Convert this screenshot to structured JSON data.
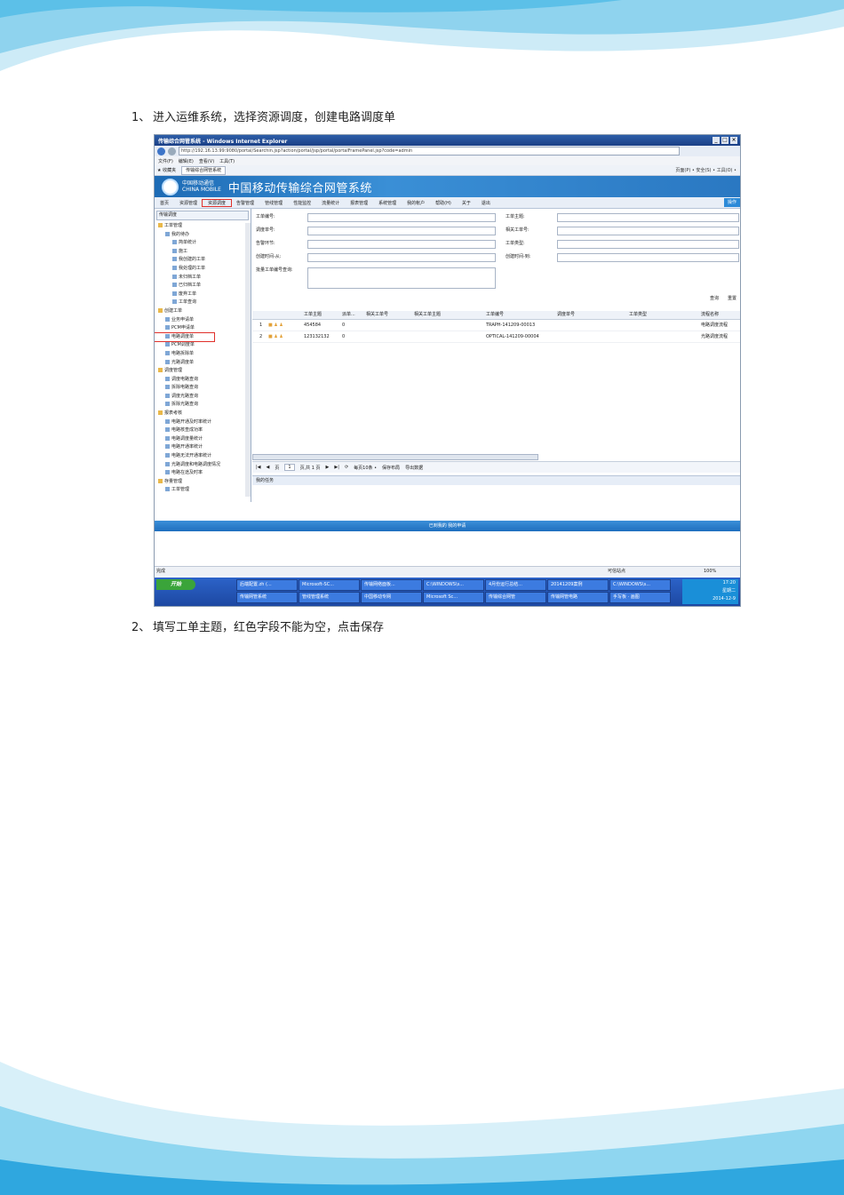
{
  "steps": {
    "step1_num": "1、",
    "step1_text": "进入运维系统，选择资源调度，创建电路调度单",
    "step2_num": "2、",
    "step2_text": "填写工单主题，红色字段不能为空，点击保存"
  },
  "browser": {
    "title": "传输综合网管系统 - Windows Internet Explorer",
    "url": "http://192.16.13.99:9080/portal/Searchin.jsp?action/portal/jsp/portal/portalFramePanel.jsp?code=admin",
    "menu": [
      "文件(F)",
      "编辑(E)",
      "查看(V)",
      "工具(T)"
    ],
    "favorites_label": "收藏夹",
    "tab_label": "传输综合网管系统",
    "tools_text": "页面(P) • 安全(S) • 工具(O) •"
  },
  "app": {
    "logo_cn": "中国移动通信",
    "logo_en": "CHINA MOBILE",
    "system_title": "中国移动传输综合网管系统",
    "nav": [
      "首页",
      "资源管理",
      "资源调度",
      "告警管理",
      "管线管理",
      "性能监控",
      "流量统计",
      "报表管理",
      "系统管理",
      "我的帐户",
      "帮助(H)",
      "关于",
      "退出"
    ],
    "nav_right": "操作"
  },
  "tree": {
    "header": "传输调度",
    "items": [
      {
        "label": "工单管理",
        "level": 0
      },
      {
        "label": "我的待办",
        "level": 1
      },
      {
        "label": "简单统计",
        "level": 2
      },
      {
        "label": "施工",
        "level": 2
      },
      {
        "label": "我创建的工单",
        "level": 2
      },
      {
        "label": "我处理的工单",
        "level": 2
      },
      {
        "label": "未归档工单",
        "level": 2
      },
      {
        "label": "已归档工单",
        "level": 2
      },
      {
        "label": "废弃工单",
        "level": 2
      },
      {
        "label": "工单查询",
        "level": 2
      },
      {
        "label": "创建工单",
        "level": 0
      },
      {
        "label": "业务申请单",
        "level": 1
      },
      {
        "label": "PCM申请单",
        "level": 1
      },
      {
        "label": "电路调度单",
        "level": 1
      },
      {
        "label": "PCM调度单",
        "level": 1
      },
      {
        "label": "电路拆除单",
        "level": 1
      },
      {
        "label": "光路调度单",
        "level": 1
      },
      {
        "label": "调度管理",
        "level": 0
      },
      {
        "label": "调度电路查询",
        "level": 1
      },
      {
        "label": "拆除电路查询",
        "level": 1
      },
      {
        "label": "调度光路查询",
        "level": 1
      },
      {
        "label": "拆除光路查询",
        "level": 1
      },
      {
        "label": "报表考核",
        "level": 0
      },
      {
        "label": "电路开通及时率统计",
        "level": 1
      },
      {
        "label": "电路核查成功率",
        "level": 1
      },
      {
        "label": "电路调度量统计",
        "level": 1
      },
      {
        "label": "电路开通率统计",
        "level": 1
      },
      {
        "label": "电路无法开通率统计",
        "level": 1
      },
      {
        "label": "光路调度和电路调度情况",
        "level": 1
      },
      {
        "label": "电路在途及时率",
        "level": 1
      },
      {
        "label": "存量管理",
        "level": 0
      },
      {
        "label": "工单管理",
        "level": 1
      }
    ]
  },
  "form": {
    "work_no": "工单编号:",
    "subject": "工单主题:",
    "dispatch_no": "调度单号:",
    "related_no": "相关工单号:",
    "belong": "告警环节:",
    "work_type": "工单类型:",
    "create_from": "创建时间-从:",
    "create_to": "创建时间-到:",
    "batch_query": "批量工单编号查询:"
  },
  "toolbar": {
    "query": "查询",
    "reset": "重置"
  },
  "grid": {
    "columns": [
      "工单主题",
      "派单...",
      "相关工单号",
      "相关工单主题",
      "工单编号",
      "调度单号",
      "工单类型",
      "流程名称"
    ],
    "rows": [
      {
        "idx": "1",
        "subject": "454584",
        "dispatch": "0",
        "work_no": "TRAPH-141209-00013",
        "flow": "电路调度流程"
      },
      {
        "idx": "2",
        "subject": "123132132",
        "dispatch": "0",
        "work_no": "OPTICAL-141209-00004",
        "flow": "光路调度流程"
      }
    ]
  },
  "pager": {
    "page": "页",
    "page_value": "1",
    "total": "页,共 1 页",
    "per_page": "每页10条 •",
    "save_layout": "保存布局",
    "export": "导出数据"
  },
  "my_tasks": "我的任务",
  "footer": "已到我的 我的申请",
  "status": {
    "left": "完成",
    "zone": "可信站点",
    "zoom": "100%"
  },
  "taskbar": {
    "start": "开始",
    "buttons": [
      "后端配置.zh (...",
      "Microsoft-SC...",
      "传输网络面板...",
      "C:\\WINDOWS\\s...",
      "4月份运行总结...",
      "20141209案例",
      "C:\\WINDOWS\\s...",
      "传输网管系统",
      "管线管理系统",
      "中国移动专网",
      "Microsoft Sc...",
      "传输综合网管",
      "传输网管电路",
      "手写板 · 画图"
    ],
    "clock_time": "17:20",
    "clock_day": "星期二",
    "clock_date": "2014-12-9"
  }
}
